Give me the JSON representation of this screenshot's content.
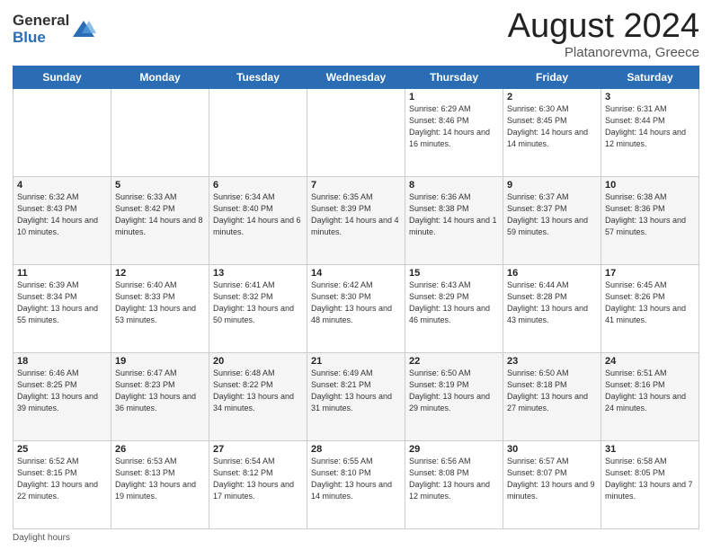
{
  "logo": {
    "general": "General",
    "blue": "Blue"
  },
  "title": {
    "month_year": "August 2024",
    "location": "Platanorevma, Greece"
  },
  "days_of_week": [
    "Sunday",
    "Monday",
    "Tuesday",
    "Wednesday",
    "Thursday",
    "Friday",
    "Saturday"
  ],
  "weeks": [
    [
      {
        "day": "",
        "info": ""
      },
      {
        "day": "",
        "info": ""
      },
      {
        "day": "",
        "info": ""
      },
      {
        "day": "",
        "info": ""
      },
      {
        "day": "1",
        "info": "Sunrise: 6:29 AM\nSunset: 8:46 PM\nDaylight: 14 hours and 16 minutes."
      },
      {
        "day": "2",
        "info": "Sunrise: 6:30 AM\nSunset: 8:45 PM\nDaylight: 14 hours and 14 minutes."
      },
      {
        "day": "3",
        "info": "Sunrise: 6:31 AM\nSunset: 8:44 PM\nDaylight: 14 hours and 12 minutes."
      }
    ],
    [
      {
        "day": "4",
        "info": "Sunrise: 6:32 AM\nSunset: 8:43 PM\nDaylight: 14 hours and 10 minutes."
      },
      {
        "day": "5",
        "info": "Sunrise: 6:33 AM\nSunset: 8:42 PM\nDaylight: 14 hours and 8 minutes."
      },
      {
        "day": "6",
        "info": "Sunrise: 6:34 AM\nSunset: 8:40 PM\nDaylight: 14 hours and 6 minutes."
      },
      {
        "day": "7",
        "info": "Sunrise: 6:35 AM\nSunset: 8:39 PM\nDaylight: 14 hours and 4 minutes."
      },
      {
        "day": "8",
        "info": "Sunrise: 6:36 AM\nSunset: 8:38 PM\nDaylight: 14 hours and 1 minute."
      },
      {
        "day": "9",
        "info": "Sunrise: 6:37 AM\nSunset: 8:37 PM\nDaylight: 13 hours and 59 minutes."
      },
      {
        "day": "10",
        "info": "Sunrise: 6:38 AM\nSunset: 8:36 PM\nDaylight: 13 hours and 57 minutes."
      }
    ],
    [
      {
        "day": "11",
        "info": "Sunrise: 6:39 AM\nSunset: 8:34 PM\nDaylight: 13 hours and 55 minutes."
      },
      {
        "day": "12",
        "info": "Sunrise: 6:40 AM\nSunset: 8:33 PM\nDaylight: 13 hours and 53 minutes."
      },
      {
        "day": "13",
        "info": "Sunrise: 6:41 AM\nSunset: 8:32 PM\nDaylight: 13 hours and 50 minutes."
      },
      {
        "day": "14",
        "info": "Sunrise: 6:42 AM\nSunset: 8:30 PM\nDaylight: 13 hours and 48 minutes."
      },
      {
        "day": "15",
        "info": "Sunrise: 6:43 AM\nSunset: 8:29 PM\nDaylight: 13 hours and 46 minutes."
      },
      {
        "day": "16",
        "info": "Sunrise: 6:44 AM\nSunset: 8:28 PM\nDaylight: 13 hours and 43 minutes."
      },
      {
        "day": "17",
        "info": "Sunrise: 6:45 AM\nSunset: 8:26 PM\nDaylight: 13 hours and 41 minutes."
      }
    ],
    [
      {
        "day": "18",
        "info": "Sunrise: 6:46 AM\nSunset: 8:25 PM\nDaylight: 13 hours and 39 minutes."
      },
      {
        "day": "19",
        "info": "Sunrise: 6:47 AM\nSunset: 8:23 PM\nDaylight: 13 hours and 36 minutes."
      },
      {
        "day": "20",
        "info": "Sunrise: 6:48 AM\nSunset: 8:22 PM\nDaylight: 13 hours and 34 minutes."
      },
      {
        "day": "21",
        "info": "Sunrise: 6:49 AM\nSunset: 8:21 PM\nDaylight: 13 hours and 31 minutes."
      },
      {
        "day": "22",
        "info": "Sunrise: 6:50 AM\nSunset: 8:19 PM\nDaylight: 13 hours and 29 minutes."
      },
      {
        "day": "23",
        "info": "Sunrise: 6:50 AM\nSunset: 8:18 PM\nDaylight: 13 hours and 27 minutes."
      },
      {
        "day": "24",
        "info": "Sunrise: 6:51 AM\nSunset: 8:16 PM\nDaylight: 13 hours and 24 minutes."
      }
    ],
    [
      {
        "day": "25",
        "info": "Sunrise: 6:52 AM\nSunset: 8:15 PM\nDaylight: 13 hours and 22 minutes."
      },
      {
        "day": "26",
        "info": "Sunrise: 6:53 AM\nSunset: 8:13 PM\nDaylight: 13 hours and 19 minutes."
      },
      {
        "day": "27",
        "info": "Sunrise: 6:54 AM\nSunset: 8:12 PM\nDaylight: 13 hours and 17 minutes."
      },
      {
        "day": "28",
        "info": "Sunrise: 6:55 AM\nSunset: 8:10 PM\nDaylight: 13 hours and 14 minutes."
      },
      {
        "day": "29",
        "info": "Sunrise: 6:56 AM\nSunset: 8:08 PM\nDaylight: 13 hours and 12 minutes."
      },
      {
        "day": "30",
        "info": "Sunrise: 6:57 AM\nSunset: 8:07 PM\nDaylight: 13 hours and 9 minutes."
      },
      {
        "day": "31",
        "info": "Sunrise: 6:58 AM\nSunset: 8:05 PM\nDaylight: 13 hours and 7 minutes."
      }
    ]
  ],
  "footer": {
    "daylight_label": "Daylight hours"
  }
}
